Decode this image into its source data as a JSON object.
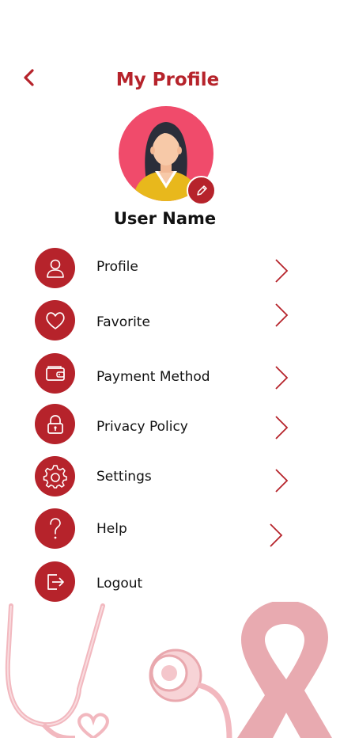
{
  "header": {
    "title": "My Profile"
  },
  "profile": {
    "user_name": "User Name"
  },
  "menu": {
    "items": [
      {
        "label": "Profile",
        "icon": "user-icon"
      },
      {
        "label": "Favorite",
        "icon": "heart-icon"
      },
      {
        "label": "Payment Method",
        "icon": "wallet-icon"
      },
      {
        "label": "Privacy Policy",
        "icon": "lock-icon"
      },
      {
        "label": "Settings",
        "icon": "gear-icon"
      },
      {
        "label": "Help",
        "icon": "question-icon"
      },
      {
        "label": "Logout",
        "icon": "logout-icon"
      }
    ]
  },
  "colors": {
    "accent": "#b6232b",
    "avatar_bg": "#f04b6b",
    "ribbon": "#e8aab0"
  }
}
